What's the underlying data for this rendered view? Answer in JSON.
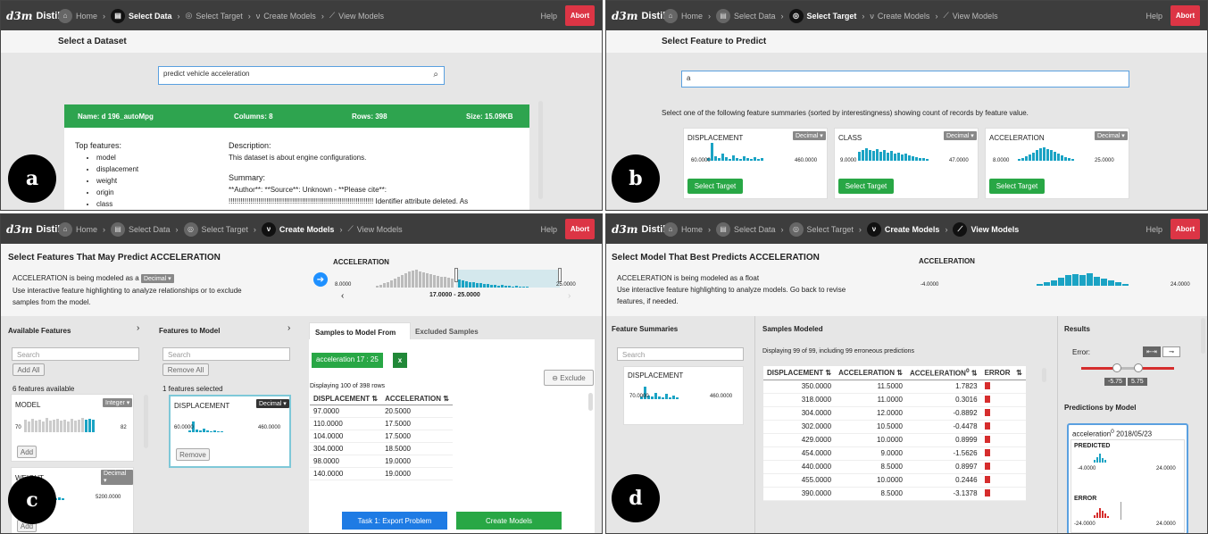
{
  "nav": {
    "app": "Distil",
    "logo": "d3m",
    "home": "Home",
    "select_data": "Select Data",
    "select_target": "Select Target",
    "create_models": "Create Models",
    "view_models": "View Models",
    "help": "Help",
    "abort": "Abort"
  },
  "panel_a": {
    "letter": "a",
    "title": "Select a Dataset",
    "search_value": "predict vehicle acceleration",
    "result": {
      "name": "Name: d 196_autoMpg",
      "columns": "Columns: 8",
      "rows": "Rows: 398",
      "size": "Size: 15.09KB"
    },
    "top_features_title": "Top features:",
    "top_features": [
      "model",
      "displacement",
      "weight",
      "origin",
      "class"
    ],
    "description_title": "Description:",
    "description": "This dataset is about engine configurations.",
    "summary_title": "Summary:",
    "summary_line1": "**Author**: **Source**: Unknown - **Please cite**:",
    "summary_line2": "!!!!!!!!!!!!!!!!!!!!!!!!!!!!!!!!!!!!!!!!!!!!!!!!!!!!!!!!!!!!!!!!!!!!!!!!! Identifier attribute deleted. As"
  },
  "panel_b": {
    "letter": "b",
    "title": "Select Feature to Predict",
    "search_value": "a",
    "instructions": "Select one of the following feature summaries (sorted by interestingness) showing count of records by feature value.",
    "cards": [
      {
        "name": "DISPLACEMENT",
        "type": "Decimal",
        "min": "60.0000",
        "max": "460.0000",
        "button": "Select Target"
      },
      {
        "name": "CLASS",
        "type": "Decimal",
        "min": "9.0000",
        "max": "47.0000",
        "button": "Select Target"
      },
      {
        "name": "ACCELERATION",
        "type": "Decimal",
        "min": "8.0000",
        "max": "25.0000",
        "button": "Select Target"
      }
    ]
  },
  "panel_c": {
    "letter": "c",
    "title": "Select Features That May Predict ACCELERATION",
    "line1_pre": "ACCELERATION is being modeled as a",
    "type": "Decimal",
    "line2": "Use interactive feature highlighting to analyze relationships or to exclude",
    "line3": "samples from the model.",
    "hist_title": "ACCELERATION",
    "hist_min": "8.0000",
    "hist_max": "25.0000",
    "range": "17.0000 - 25.0000",
    "available_title": "Available Features",
    "search_placeholder": "Search",
    "add_all": "Add All",
    "features_available": "6 features available",
    "avail_cards": [
      {
        "name": "MODEL",
        "type": "Integer",
        "min": "70",
        "max": "82",
        "button": "Add"
      },
      {
        "name": "WEIGHT",
        "type": "Decimal",
        "max": "5200.0000",
        "button": "Add"
      }
    ],
    "to_model_title": "Features to Model",
    "remove_all": "Remove All",
    "features_selected": "1 features selected",
    "model_card": {
      "name": "DISPLACEMENT",
      "type": "Decimal",
      "min": "60.0000",
      "max": "460.0000",
      "button": "Remove"
    },
    "tab_from": "Samples to Model From",
    "tab_excluded": "Excluded Samples",
    "filter_chip": "acceleration 17 : 25",
    "chip_close": "x",
    "exclude": "Exclude",
    "displaying": "Displaying 100 of 398 rows",
    "columns": [
      "DISPLACEMENT",
      "ACCELERATION"
    ],
    "rows": [
      [
        "97.0000",
        "20.5000"
      ],
      [
        "110.0000",
        "17.5000"
      ],
      [
        "104.0000",
        "17.5000"
      ],
      [
        "304.0000",
        "18.5000"
      ],
      [
        "98.0000",
        "19.0000"
      ],
      [
        "140.0000",
        "19.0000"
      ]
    ],
    "export_btn": "Task 1: Export Problem",
    "create_btn": "Create Models"
  },
  "panel_d": {
    "letter": "d",
    "title": "Select Model That Best Predicts ACCELERATION",
    "line1": "ACCELERATION is being modeled as a float",
    "line2": "Use interactive feature highlighting to analyze models. Go back to revise",
    "line3": "features, if needed.",
    "hist_title": "ACCELERATION",
    "hist_min": "-4.0000",
    "hist_max": "24.0000",
    "summaries_title": "Feature Summaries",
    "search_placeholder": "Search",
    "card": {
      "name": "DISPLACEMENT",
      "min": "70.0000",
      "max": "460.0000"
    },
    "samples_title": "Samples Modeled",
    "displaying": "Displaying 99 of 99, including 99 erroneous predictions",
    "columns": [
      "DISPLACEMENT",
      "ACCELERATION",
      "ACCELERATION",
      "ERROR"
    ],
    "rows": [
      [
        "350.0000",
        "11.5000",
        "1.7823"
      ],
      [
        "318.0000",
        "11.0000",
        "0.3016"
      ],
      [
        "304.0000",
        "12.0000",
        "-0.8892"
      ],
      [
        "302.0000",
        "10.5000",
        "-0.4478"
      ],
      [
        "429.0000",
        "10.0000",
        "0.8999"
      ],
      [
        "454.0000",
        "9.0000",
        "-1.5626"
      ],
      [
        "440.0000",
        "8.5000",
        "0.8997"
      ],
      [
        "455.0000",
        "10.0000",
        "0.2446"
      ],
      [
        "390.0000",
        "8.5000",
        "-3.1378"
      ]
    ],
    "results_title": "Results",
    "error_label": "Error:",
    "err_low": "-5.75",
    "err_high": "5.75",
    "predictions_title": "Predictions by Model",
    "model_name": "acceleration",
    "model_date": "2018/05/23",
    "predicted": "PREDICTED",
    "pred_min": "-4.0000",
    "pred_max": "24.0000",
    "error": "ERROR",
    "e_min": "-24.0000",
    "e_max": "24.0000"
  },
  "colors": {
    "accent": "#1aa3c4",
    "green": "#28a745",
    "red": "#dc3545",
    "blue": "#1e7be4"
  }
}
